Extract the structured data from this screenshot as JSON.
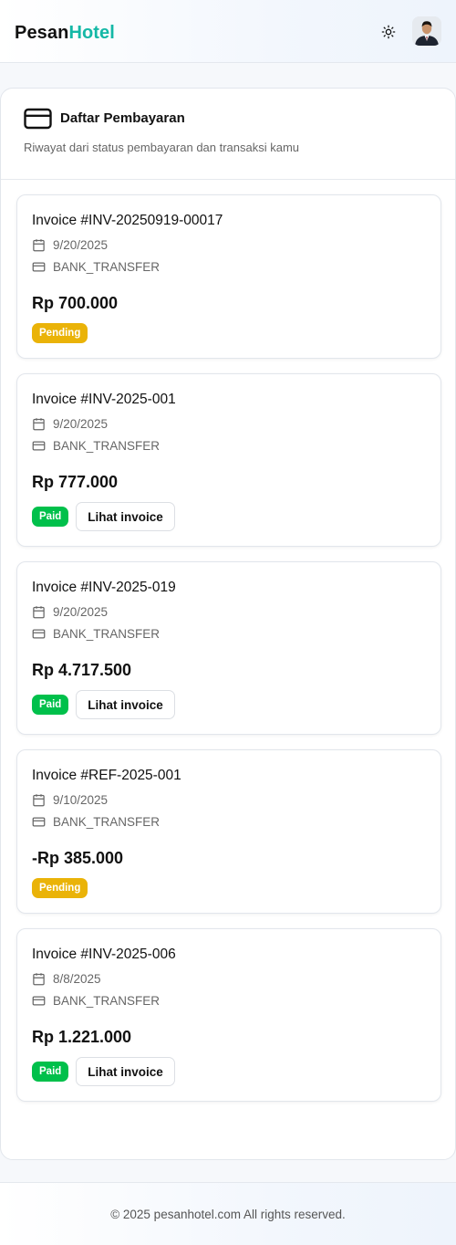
{
  "header": {
    "logo_part1": "Pesan",
    "logo_part2": "Hotel",
    "theme_icon": "sun-icon",
    "avatar_icon": "user-avatar"
  },
  "panel": {
    "icon": "credit-card-icon",
    "title": "Daftar Pembayaran",
    "subtitle": "Riwayat dari status pembayaran dan transaksi kamu"
  },
  "colors": {
    "brand_accent": "#14b8a6",
    "pending": "#eab308",
    "paid": "#00c04b"
  },
  "payments": [
    {
      "title": "Invoice #INV-20250919-00017",
      "date": "9/20/2025",
      "method": "BANK_TRANSFER",
      "amount": "Rp 700.000",
      "status": "Pending",
      "invoice_label": ""
    },
    {
      "title": "Invoice #INV-2025-001",
      "date": "9/20/2025",
      "method": "BANK_TRANSFER",
      "amount": "Rp 777.000",
      "status": "Paid",
      "invoice_label": "Lihat invoice"
    },
    {
      "title": "Invoice #INV-2025-019",
      "date": "9/20/2025",
      "method": "BANK_TRANSFER",
      "amount": "Rp 4.717.500",
      "status": "Paid",
      "invoice_label": "Lihat invoice"
    },
    {
      "title": "Invoice #REF-2025-001",
      "date": "9/10/2025",
      "method": "BANK_TRANSFER",
      "amount": "-Rp 385.000",
      "status": "Pending",
      "invoice_label": ""
    },
    {
      "title": "Invoice #INV-2025-006",
      "date": "8/8/2025",
      "method": "BANK_TRANSFER",
      "amount": "Rp 1.221.000",
      "status": "Paid",
      "invoice_label": "Lihat invoice"
    }
  ],
  "footer": {
    "text": "© 2025 pesanhotel.com All rights reserved."
  }
}
